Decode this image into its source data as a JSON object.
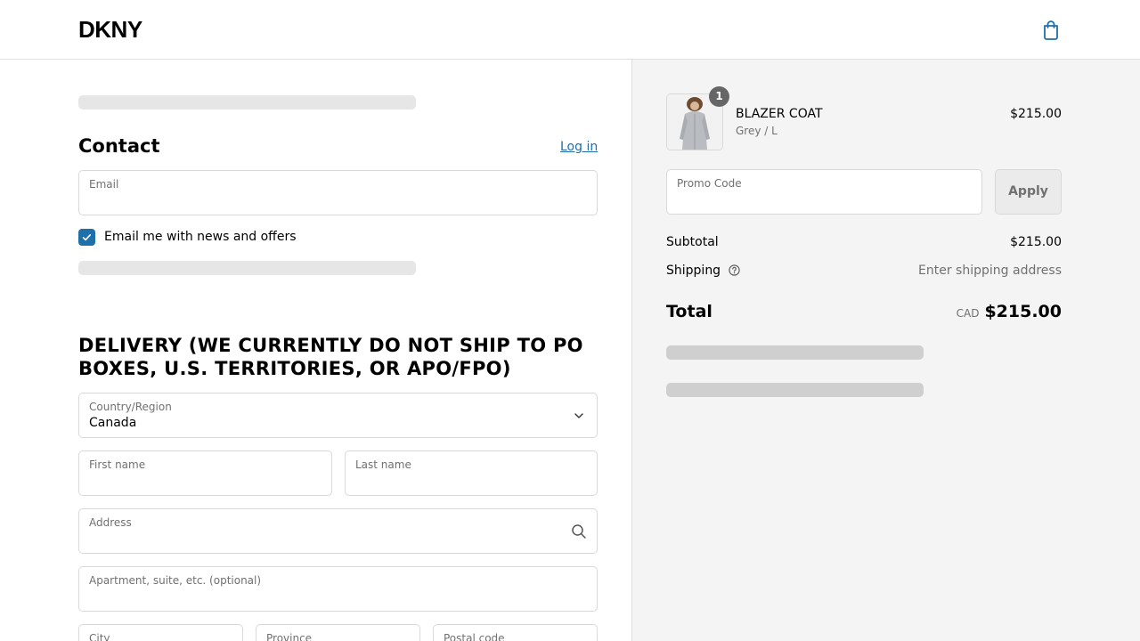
{
  "header": {
    "logo": "DKNY",
    "cart_icon": "shopping-bag-icon"
  },
  "contact": {
    "title": "Contact",
    "login_link": "Log in",
    "email_label": "Email",
    "email_value": "",
    "newsletter_label": "Email me with news and offers",
    "newsletter_checked": true
  },
  "delivery": {
    "title": "DELIVERY (WE CURRENTLY DO NOT SHIP TO PO BOXES, U.S. TERRITORIES, OR APO/FPO)",
    "country_label": "Country/Region",
    "country_value": "Canada",
    "first_name_label": "First name",
    "last_name_label": "Last name",
    "address_label": "Address",
    "apartment_label": "Apartment, suite, etc. (optional)",
    "city_label": "City",
    "province_label": "Province",
    "postal_label": "Postal code"
  },
  "summary": {
    "product": {
      "name": "BLAZER COAT",
      "variant": "Grey / L",
      "price": "$215.00",
      "quantity": "1"
    },
    "promo_label": "Promo Code",
    "apply_label": "Apply",
    "subtotal_label": "Subtotal",
    "subtotal_value": "$215.00",
    "shipping_label": "Shipping",
    "shipping_value": "Enter shipping address",
    "total_label": "Total",
    "currency": "CAD",
    "total_value": "$215.00"
  },
  "colors": {
    "accent": "#1f6fa8",
    "summary_bg": "#f4f4f4",
    "border": "#d9d9d9"
  }
}
